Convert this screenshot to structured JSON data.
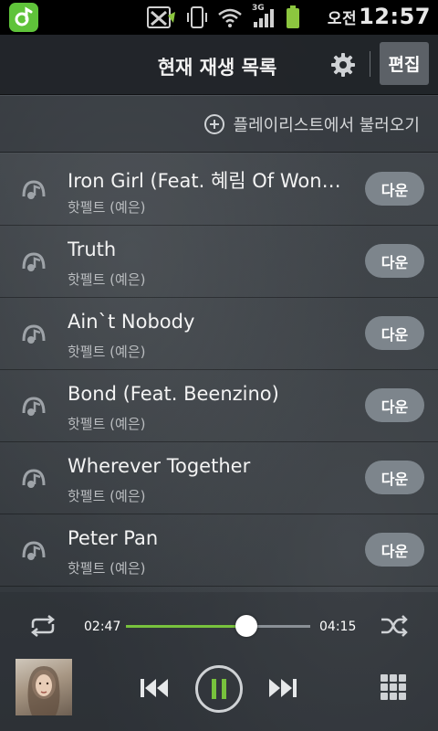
{
  "status_bar": {
    "ampm": "오전",
    "time": "12:57",
    "network": "3G"
  },
  "header": {
    "title": "현재 재생 목록",
    "edit_label": "편집"
  },
  "load_playlist": {
    "label": "플레이리스트에서 불러오기"
  },
  "songs": [
    {
      "title": "Iron Girl (Feat. 혜림 Of Wonder Girls)",
      "artist": "핫펠트 (예은)",
      "download_label": "다운"
    },
    {
      "title": "Truth",
      "artist": "핫펠트 (예은)",
      "download_label": "다운"
    },
    {
      "title": "Ain`t Nobody",
      "artist": "핫펠트 (예은)",
      "download_label": "다운"
    },
    {
      "title": "Bond (Feat. Beenzino)",
      "artist": "핫펠트 (예은)",
      "download_label": "다운"
    },
    {
      "title": "Wherever Together",
      "artist": "핫펠트 (예은)",
      "download_label": "다운"
    },
    {
      "title": "Peter Pan",
      "artist": "핫펠트 (예은)",
      "download_label": "다운"
    }
  ],
  "player": {
    "elapsed": "02:47",
    "total": "04:15",
    "progress": 0.655,
    "state": "playing"
  },
  "colors": {
    "accent": "#78c23d",
    "button": "#7d858c",
    "header": "#1e2226"
  },
  "icons": {
    "app": "music-app-icon",
    "settings": "gear-icon",
    "load": "plus-circle-icon",
    "song": "now-playing-note-icon",
    "repeat": "repeat-icon",
    "shuffle": "shuffle-icon",
    "prev": "previous-icon",
    "play": "pause-icon",
    "next": "next-icon",
    "menu": "grid-menu-icon"
  }
}
